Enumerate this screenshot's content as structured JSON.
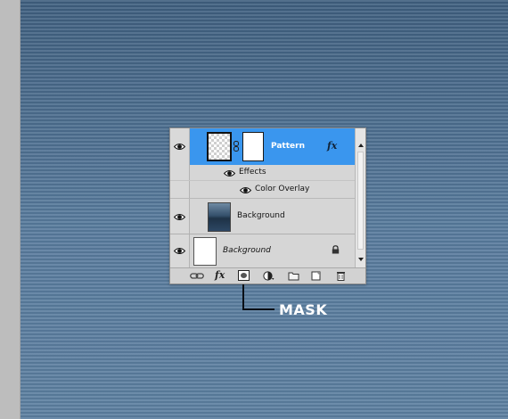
{
  "layers_panel": {
    "layers": [
      {
        "name": "Pattern",
        "visible": true,
        "selected": true,
        "has_fx": true,
        "fx_label": "fx",
        "effects": {
          "label": "Effects",
          "items": [
            "Color Overlay"
          ]
        }
      },
      {
        "name": "Background",
        "visible": true,
        "selected": false
      },
      {
        "name": "Background",
        "visible": true,
        "selected": false,
        "locked": true
      }
    ],
    "toolbar": {
      "link_icon": "link-layers-icon",
      "fx_label": "fx",
      "mask_icon": "add-layer-mask-icon",
      "adjustment_icon": "adjustment-layer-icon",
      "group_icon": "new-group-folder-icon",
      "new_layer_icon": "new-layer-icon",
      "delete_icon": "trash-icon"
    }
  },
  "annotation": {
    "label": "MASK"
  },
  "colors": {
    "selection": "#3a96ee",
    "panel": "#d6d6d6",
    "canvas": "#4d6d8c"
  }
}
